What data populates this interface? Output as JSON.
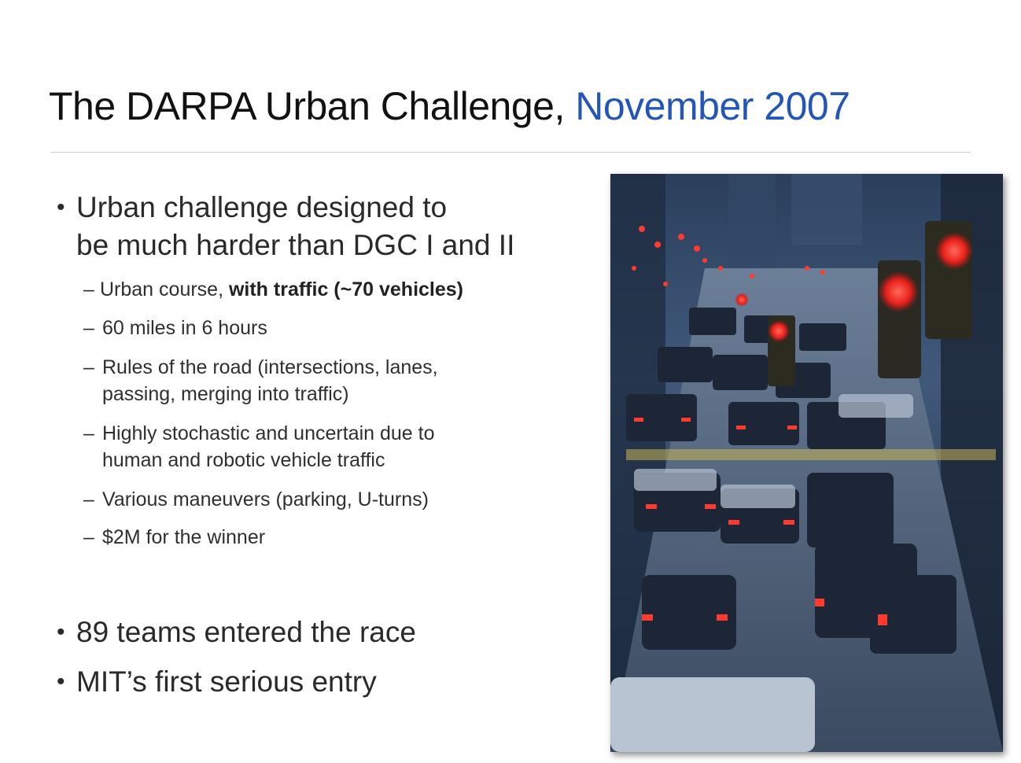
{
  "slide": {
    "title_main": "The DARPA Urban Challenge, ",
    "title_accent": "November 2007",
    "accent_color": "#2456b8",
    "bullets": [
      {
        "line1": "Urban challenge designed to",
        "line2": "be much harder than DGC I and II"
      },
      {
        "text": "89 teams entered the race"
      },
      {
        "text": "MIT’s first serious entry"
      }
    ],
    "sub_bullets": [
      {
        "plain": "Urban course, ",
        "bold": "with traffic (~70 vehicles)"
      },
      {
        "line1": "60 miles in 6 hours"
      },
      {
        "line1": "Rules of the road (intersections, lanes,",
        "line2": "passing, merging into traffic)"
      },
      {
        "line1": "Highly stochastic and uncertain due to",
        "line2": "human and robotic vehicle traffic"
      },
      {
        "line1": "Various maneuvers (parking, U-turns)"
      },
      {
        "line1": "$2M for the winner"
      }
    ],
    "bullet_glyph": "•",
    "dash_glyph": "–",
    "photo": {
      "subject": "city-traffic-photo"
    }
  }
}
